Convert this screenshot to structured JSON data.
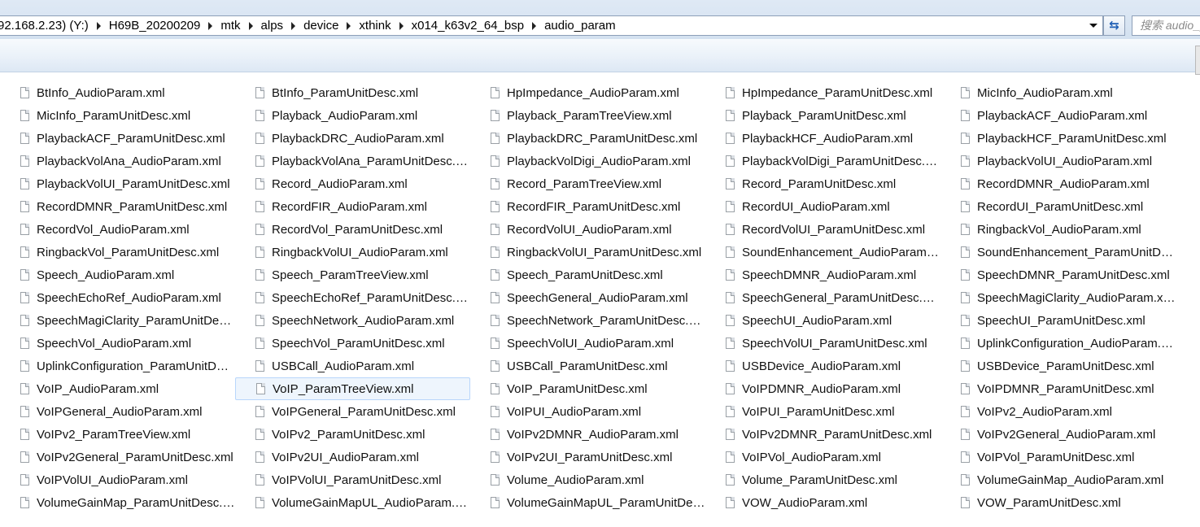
{
  "address": {
    "crumbs": [
      "92.168.2.23) (Y:)",
      "H69B_20200209",
      "mtk",
      "alps",
      "device",
      "xthink",
      "x014_k63v2_64_bsp",
      "audio_param"
    ]
  },
  "search": {
    "placeholder": "搜索 audio_param"
  },
  "selected_index": 66,
  "files": [
    "BtInfo_AudioParam.xml",
    "BtInfo_ParamUnitDesc.xml",
    "HpImpedance_AudioParam.xml",
    "HpImpedance_ParamUnitDesc.xml",
    "MicInfo_AudioParam.xml",
    "MicInfo_ParamUnitDesc.xml",
    "Playback_AudioParam.xml",
    "Playback_ParamTreeView.xml",
    "Playback_ParamUnitDesc.xml",
    "PlaybackACF_AudioParam.xml",
    "PlaybackACF_ParamUnitDesc.xml",
    "PlaybackDRC_AudioParam.xml",
    "PlaybackDRC_ParamUnitDesc.xml",
    "PlaybackHCF_AudioParam.xml",
    "PlaybackHCF_ParamUnitDesc.xml",
    "PlaybackVolAna_AudioParam.xml",
    "PlaybackVolAna_ParamUnitDesc.xml",
    "PlaybackVolDigi_AudioParam.xml",
    "PlaybackVolDigi_ParamUnitDesc.xml",
    "PlaybackVolUI_AudioParam.xml",
    "PlaybackVolUI_ParamUnitDesc.xml",
    "Record_AudioParam.xml",
    "Record_ParamTreeView.xml",
    "Record_ParamUnitDesc.xml",
    "RecordDMNR_AudioParam.xml",
    "RecordDMNR_ParamUnitDesc.xml",
    "RecordFIR_AudioParam.xml",
    "RecordFIR_ParamUnitDesc.xml",
    "RecordUI_AudioParam.xml",
    "RecordUI_ParamUnitDesc.xml",
    "RecordVol_AudioParam.xml",
    "RecordVol_ParamUnitDesc.xml",
    "RecordVolUI_AudioParam.xml",
    "RecordVolUI_ParamUnitDesc.xml",
    "RingbackVol_AudioParam.xml",
    "RingbackVol_ParamUnitDesc.xml",
    "RingbackVolUI_AudioParam.xml",
    "RingbackVolUI_ParamUnitDesc.xml",
    "SoundEnhancement_AudioParam.xml",
    "SoundEnhancement_ParamUnitDesc.xml",
    "Speech_AudioParam.xml",
    "Speech_ParamTreeView.xml",
    "Speech_ParamUnitDesc.xml",
    "SpeechDMNR_AudioParam.xml",
    "SpeechDMNR_ParamUnitDesc.xml",
    "SpeechEchoRef_AudioParam.xml",
    "SpeechEchoRef_ParamUnitDesc.xml",
    "SpeechGeneral_AudioParam.xml",
    "SpeechGeneral_ParamUnitDesc.xml",
    "SpeechMagiClarity_AudioParam.xml",
    "SpeechMagiClarity_ParamUnitDesc.xml",
    "SpeechNetwork_AudioParam.xml",
    "SpeechNetwork_ParamUnitDesc.xml",
    "SpeechUI_AudioParam.xml",
    "SpeechUI_ParamUnitDesc.xml",
    "SpeechVol_AudioParam.xml",
    "SpeechVol_ParamUnitDesc.xml",
    "SpeechVolUI_AudioParam.xml",
    "SpeechVolUI_ParamUnitDesc.xml",
    "UplinkConfiguration_AudioParam.xml",
    "UplinkConfiguration_ParamUnitDesc.xml",
    "USBCall_AudioParam.xml",
    "USBCall_ParamUnitDesc.xml",
    "USBDevice_AudioParam.xml",
    "USBDevice_ParamUnitDesc.xml",
    "VoIP_AudioParam.xml",
    "VoIP_ParamTreeView.xml",
    "VoIP_ParamUnitDesc.xml",
    "VoIPDMNR_AudioParam.xml",
    "VoIPDMNR_ParamUnitDesc.xml",
    "VoIPGeneral_AudioParam.xml",
    "VoIPGeneral_ParamUnitDesc.xml",
    "VoIPUI_AudioParam.xml",
    "VoIPUI_ParamUnitDesc.xml",
    "VoIPv2_AudioParam.xml",
    "VoIPv2_ParamTreeView.xml",
    "VoIPv2_ParamUnitDesc.xml",
    "VoIPv2DMNR_AudioParam.xml",
    "VoIPv2DMNR_ParamUnitDesc.xml",
    "VoIPv2General_AudioParam.xml",
    "VoIPv2General_ParamUnitDesc.xml",
    "VoIPv2UI_AudioParam.xml",
    "VoIPv2UI_ParamUnitDesc.xml",
    "VoIPVol_AudioParam.xml",
    "VoIPVol_ParamUnitDesc.xml",
    "VoIPVolUI_AudioParam.xml",
    "VoIPVolUI_ParamUnitDesc.xml",
    "Volume_AudioParam.xml",
    "Volume_ParamUnitDesc.xml",
    "VolumeGainMap_AudioParam.xml",
    "VolumeGainMap_ParamUnitDesc.xml",
    "VolumeGainMapUL_AudioParam.xml",
    "VolumeGainMapUL_ParamUnitDesc.xml",
    "VOW_AudioParam.xml",
    "VOW_ParamUnitDesc.xml"
  ]
}
